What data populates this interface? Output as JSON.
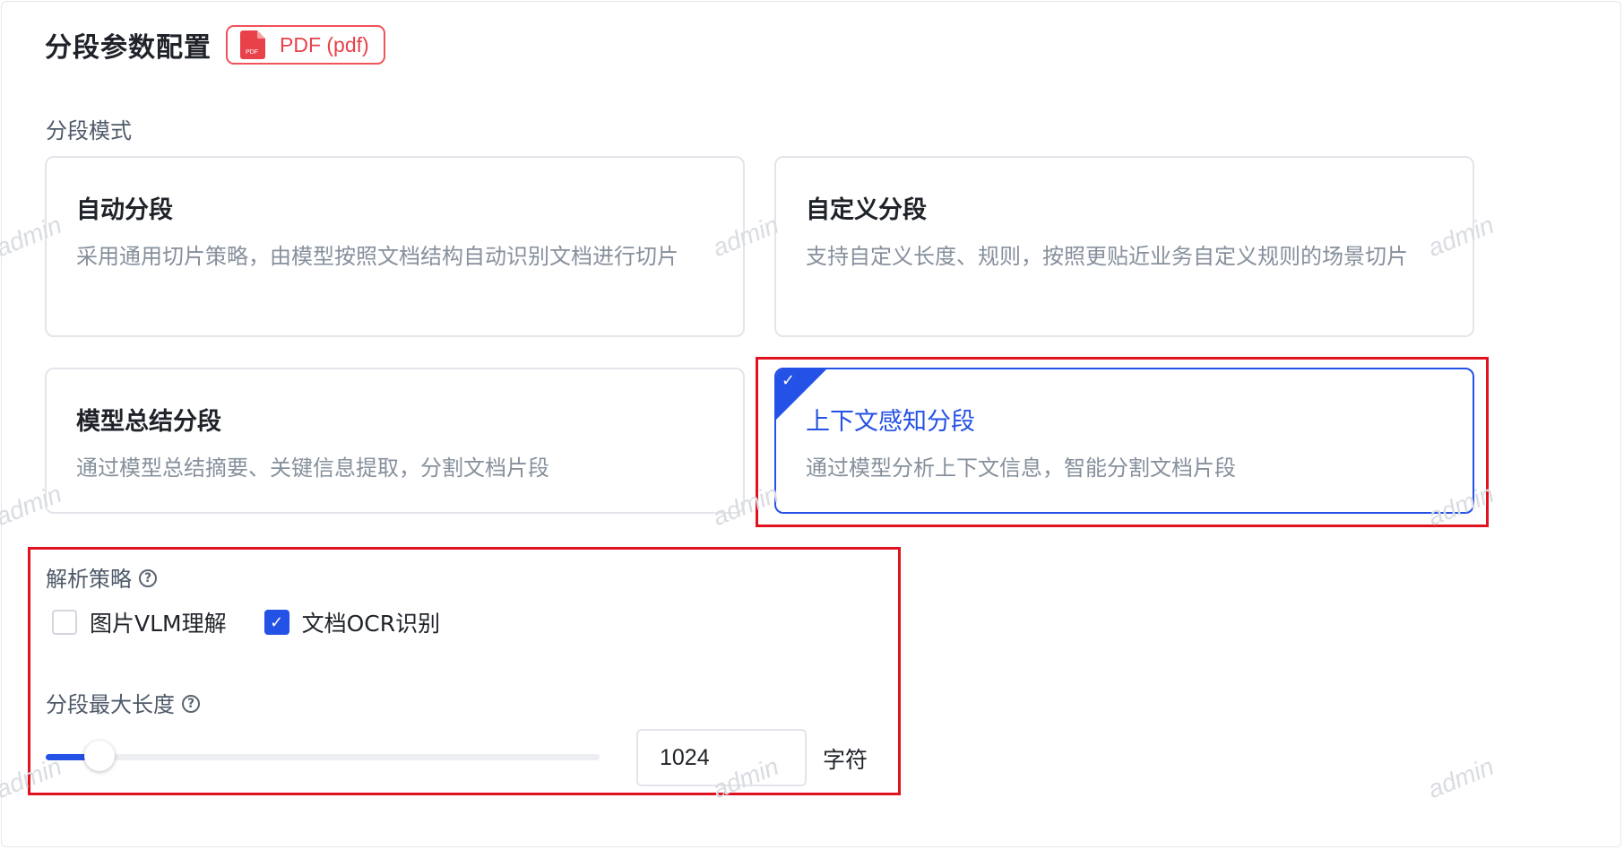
{
  "header": {
    "title": "分段参数配置",
    "file_badge": {
      "label": "PDF (pdf)",
      "icon": "pdf-file-icon",
      "icon_text": "PDF",
      "color": "#e8414a"
    }
  },
  "segment_mode": {
    "label": "分段模式",
    "options": [
      {
        "title": "自动分段",
        "description": "采用通用切片策略，由模型按照文档结构自动识别文档进行切片",
        "selected": false
      },
      {
        "title": "自定义分段",
        "description": "支持自定义长度、规则，按照更贴近业务自定义规则的场景切片",
        "selected": false
      },
      {
        "title": "模型总结分段",
        "description": "通过模型总结摘要、关键信息提取，分割文档片段",
        "selected": false
      },
      {
        "title": "上下文感知分段",
        "description": "通过模型分析上下文信息，智能分割文档片段",
        "selected": true
      }
    ],
    "selected_color": "#2451e6"
  },
  "parse_strategy": {
    "label": "解析策略",
    "help_icon": "question-circle-icon",
    "options": [
      {
        "label": "图片VLM理解",
        "checked": false
      },
      {
        "label": "文档OCR识别",
        "checked": true
      }
    ]
  },
  "max_length": {
    "label": "分段最大长度",
    "help_icon": "question-circle-icon",
    "value": "1024",
    "slider_fraction": 0.097,
    "unit": "字符"
  },
  "watermark": {
    "text": "admin"
  },
  "annotation_color": "#e0121f"
}
